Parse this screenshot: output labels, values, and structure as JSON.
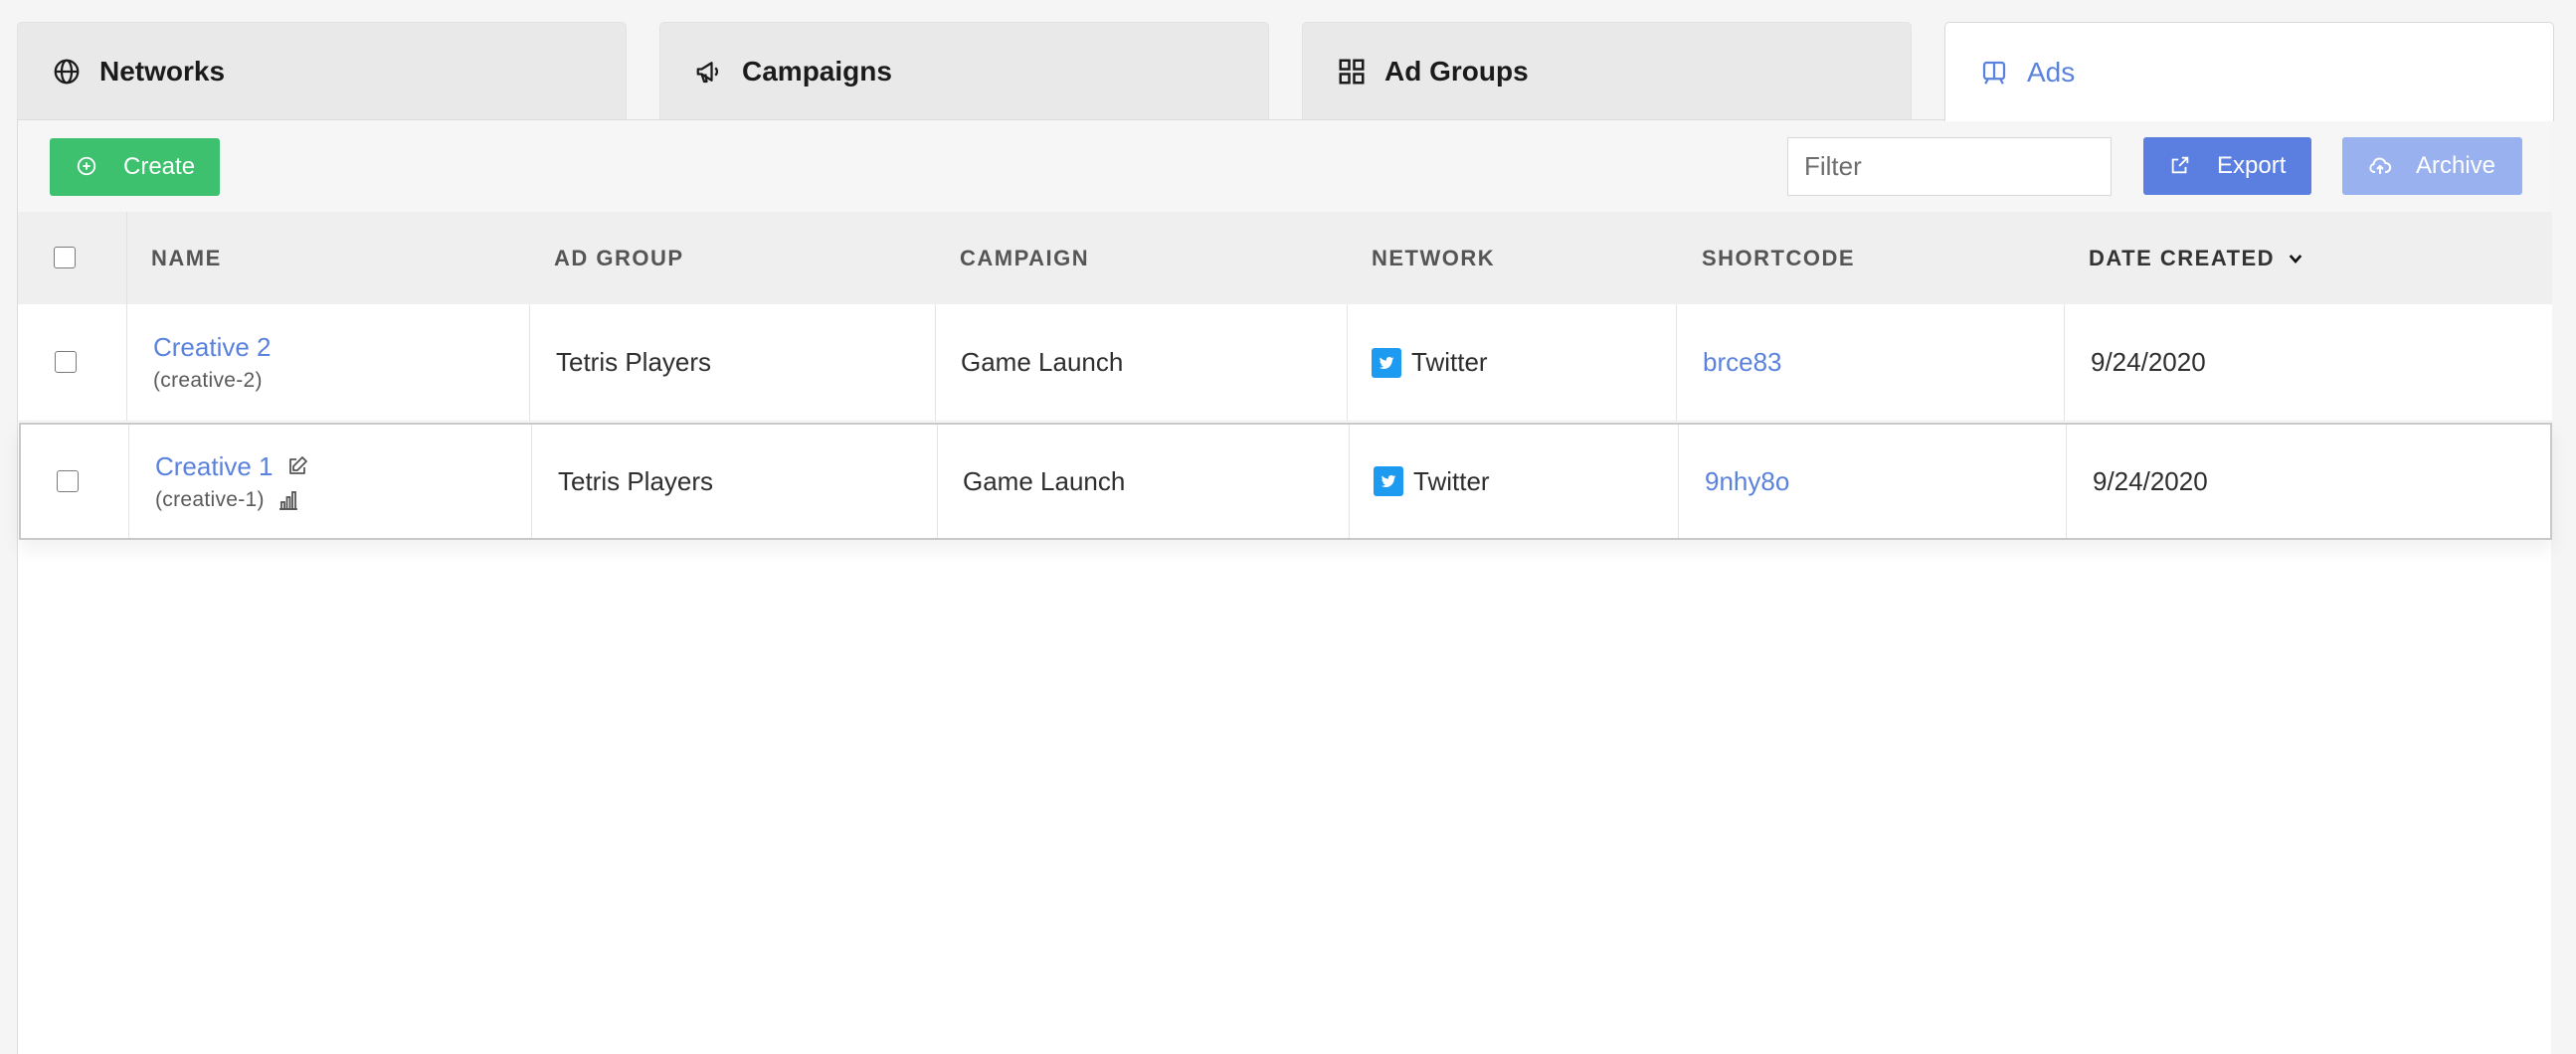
{
  "tabs": [
    {
      "label": "Networks",
      "icon": "globe-icon"
    },
    {
      "label": "Campaigns",
      "icon": "megaphone-icon"
    },
    {
      "label": "Ad Groups",
      "icon": "grid-icon"
    },
    {
      "label": "Ads",
      "icon": "ad-icon",
      "active": true
    }
  ],
  "toolbar": {
    "create_label": "Create",
    "filter_placeholder": "Filter",
    "export_label": "Export",
    "archive_label": "Archive"
  },
  "table": {
    "columns": [
      "NAME",
      "AD GROUP",
      "CAMPAIGN",
      "NETWORK",
      "SHORTCODE",
      "DATE CREATED"
    ],
    "sort_icon": "chevron-down-icon",
    "rows": [
      {
        "name": "Creative 2",
        "slug": "(creative-2)",
        "ad_group": "Tetris Players",
        "campaign": "Game Launch",
        "network": "Twitter",
        "shortcode": "brce83",
        "date_created": "9/24/2020"
      },
      {
        "name": "Creative 1",
        "slug": "(creative-1)",
        "ad_group": "Tetris Players",
        "campaign": "Game Launch",
        "network": "Twitter",
        "shortcode": "9nhy8o",
        "date_created": "9/24/2020"
      }
    ]
  },
  "colors": {
    "accent": "#5a82dd",
    "create": "#3ec16f",
    "export": "#5b7fe0",
    "archive": "#9ab1ef",
    "twitter": "#1d9bf0"
  }
}
